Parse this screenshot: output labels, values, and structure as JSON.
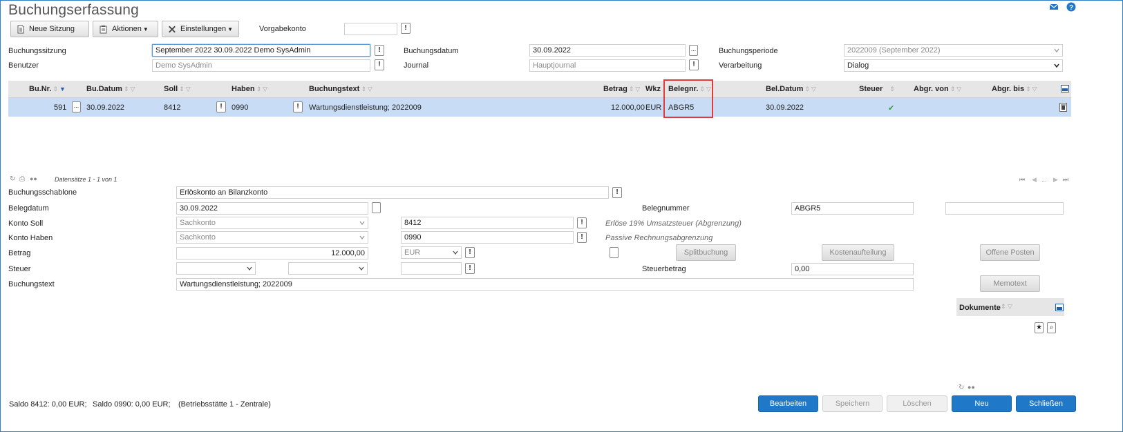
{
  "title": "Buchungserfassung",
  "toolbar": {
    "new_session": "Neue Sitzung",
    "actions": "Aktionen",
    "settings": "Einstellungen",
    "vorgabekonto_label": "Vorgabekonto",
    "vorgabekonto_value": ""
  },
  "header": {
    "buchungssitzung_label": "Buchungssitzung",
    "buchungssitzung_value": "September 2022 30.09.2022 Demo SysAdmin",
    "benutzer_label": "Benutzer",
    "benutzer_value": "Demo SysAdmin",
    "buchungsdatum_label": "Buchungsdatum",
    "buchungsdatum_value": "30.09.2022",
    "journal_label": "Journal",
    "journal_value": "Hauptjournal",
    "buchungsperiode_label": "Buchungsperiode",
    "buchungsperiode_value": "2022009 (September 2022)",
    "verarbeitung_label": "Verarbeitung",
    "verarbeitung_value": "Dialog"
  },
  "grid": {
    "columns": {
      "bunr": "Bu.Nr.",
      "budatum": "Bu.Datum",
      "soll": "Soll",
      "haben": "Haben",
      "buchungstext": "Buchungstext",
      "betrag": "Betrag",
      "wkz": "Wkz",
      "belegnr": "Belegnr.",
      "beldatum": "Bel.Datum",
      "steuer": "Steuer",
      "abgrvon": "Abgr. von",
      "abgrbis": "Abgr. bis"
    },
    "row": {
      "bunr": "591",
      "budatum": "30.09.2022",
      "soll": "8412",
      "haben": "0990",
      "buchungstext": "Wartungsdienstleistung; 2022009",
      "betrag": "12.000,00",
      "wkz": "EUR",
      "belegnr": "ABGR5",
      "beldatum": "30.09.2022",
      "steuer_check": "✔"
    },
    "records": "Datensätze 1 - 1 von 1",
    "pager_ellipsis": "..."
  },
  "detail": {
    "buchungsschablone_label": "Buchungsschablone",
    "buchungsschablone_value": "Erlöskonto an Bilanzkonto",
    "belegdatum_label": "Belegdatum",
    "belegdatum_value": "30.09.2022",
    "belegnummer_label": "Belegnummer",
    "belegnummer_value": "ABGR5",
    "konto_soll_label": "Konto Soll",
    "konto_soll_type": "Sachkonto",
    "konto_soll_value": "8412",
    "konto_soll_info": "Erlöse 19% Umsatzsteuer (Abgrenzung)",
    "konto_haben_label": "Konto Haben",
    "konto_haben_type": "Sachkonto",
    "konto_haben_value": "0990",
    "konto_haben_info": "Passive Rechnungsabgrenzung",
    "betrag_label": "Betrag",
    "betrag_value": "12.000,00",
    "currency": "EUR",
    "steuer_label": "Steuer",
    "steuerbetrag_label": "Steuerbetrag",
    "steuerbetrag_value": "0,00",
    "buchungstext_label": "Buchungstext",
    "buchungstext_value": "Wartungsdienstleistung; 2022009",
    "splitbuchung": "Splitbuchung",
    "kostenaufteilung": "Kostenaufteilung",
    "offene_posten": "Offene Posten",
    "memotext": "Memotext",
    "dokumente": "Dokumente"
  },
  "status": {
    "saldo1": "Saldo 8412: 0,00 EUR;",
    "saldo2": "Saldo 0990: 0,00 EUR;",
    "betriebsstaette": "(Betriebsstätte 1 - Zentrale)"
  },
  "footer": {
    "bearbeiten": "Bearbeiten",
    "speichern": "Speichern",
    "loeschen": "Löschen",
    "neu": "Neu",
    "schliessen": "Schließen"
  }
}
